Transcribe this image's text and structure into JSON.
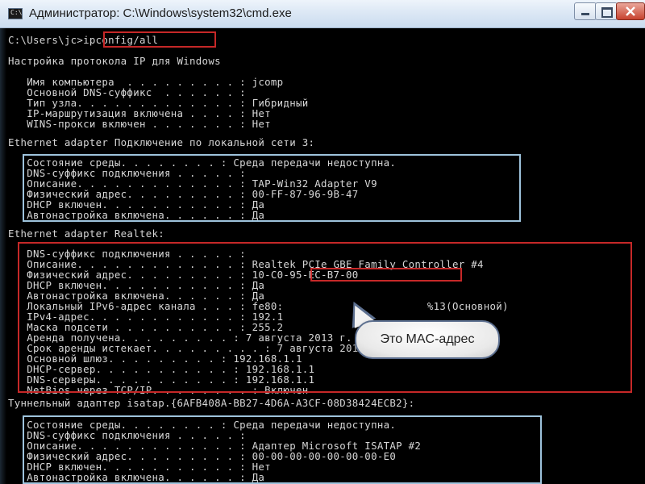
{
  "window": {
    "title": "Администратор: C:\\Windows\\system32\\cmd.exe",
    "icon": "cmd-icon",
    "controls": [
      "minimize-icon",
      "maximize-icon",
      "close-icon"
    ]
  },
  "console": {
    "lines": [
      {
        "prompt": "C:\\Users\\jc>",
        "command": "ipconfig/all"
      },
      {
        "text": "Настройка протокола IP для Windows"
      },
      {
        "text": "   Имя компьютера  . . . . . . . . . : jcomp"
      },
      {
        "text": "   Основной DNS-суффикс  . . . . . . :"
      },
      {
        "text": "   Тип узла. . . . . . . . . . . . . : Гибридный"
      },
      {
        "text": "   IP-маршрутизация включена . . . . : Нет"
      },
      {
        "text": "   WINS-прокси включен . . . . . . . : Нет"
      },
      {
        "text": "Ethernet adapter Подключение по локальной сети 3:"
      },
      {
        "text": "   Состояние среды. . . . . . . . : Среда передачи недоступна."
      },
      {
        "text": "   DNS-суффикс подключения . . . . . :"
      },
      {
        "text": "   Описание. . . . . . . . . . . . . : TAP-Win32 Adapter V9"
      },
      {
        "text": "   Физический адрес. . . . . . . . . : 00-FF-87-96-9B-47"
      },
      {
        "text": "   DHCP включен. . . . . . . . . . . : Да"
      },
      {
        "text": "   Автонастройка включена. . . . . . : Да"
      },
      {
        "text": "Ethernet adapter Realtek:"
      },
      {
        "text": "   DNS-суффикс подключения . . . . . :"
      },
      {
        "text": "   Описание. . . . . . . . . . . . . : Realtek PCIe GBE Family Controller #4"
      },
      {
        "text": "   Физический адрес. . . . . . . . . : 10-C0-95-EC-B7-00"
      },
      {
        "text": "   DHCP включен. . . . . . . . . . . : Да"
      },
      {
        "text": "   Автонастройка включена. . . . . . : Да"
      },
      {
        "text": "   Локальный IPv6-адрес канала . . . : fe80:                       %13(Основной)"
      },
      {
        "text": "   IPv4-адрес. . . . . . . . . . . . : 192.1"
      },
      {
        "text": "   Маска подсети . . . . . . . . . . : 255.2"
      },
      {
        "text": "   Аренда получена. . . . . . . . . : 7 августа 2013 г. 15:38:50"
      },
      {
        "text": "   Срок аренды истекает. . . . . . . . . : 7 августа 2013 г. 17:38:51"
      },
      {
        "text": "   Основной шлюз. . . . . . . . . : 192.168.1.1"
      },
      {
        "text": "   DHCP-сервер. . . . . . . . . . . : 192.168.1.1"
      },
      {
        "text": "   DNS-серверы. . . . . . . . . . . : 192.168.1.1"
      },
      {
        "text": "   NetBios через TCP/IP. . . . . . . . : Включен"
      },
      {
        "text": "Туннельный адаптер isatap.{6AFB408A-BB27-4D6A-A3CF-08D38424ECB2}:"
      },
      {
        "text": "   Состояние среды. . . . . . . . : Среда передачи недоступна."
      },
      {
        "text": "   DNS-суффикс подключения . . . . . :"
      },
      {
        "text": "   Описание. . . . . . . . . . . . . : Адаптер Microsoft ISATAP #2"
      },
      {
        "text": "   Физический адрес. . . . . . . . . : 00-00-00-00-00-00-00-E0"
      },
      {
        "text": "   DHCP включен. . . . . . . . . . . : Нет"
      },
      {
        "text": "   Автонастройка включена. . . . . . : Да"
      }
    ]
  },
  "callout": {
    "text": "Это MAC-адрес"
  },
  "colors": {
    "console_text": "#d6d6d6",
    "highlight_red": "#c62828",
    "highlight_blue": "#9ec3dc"
  }
}
